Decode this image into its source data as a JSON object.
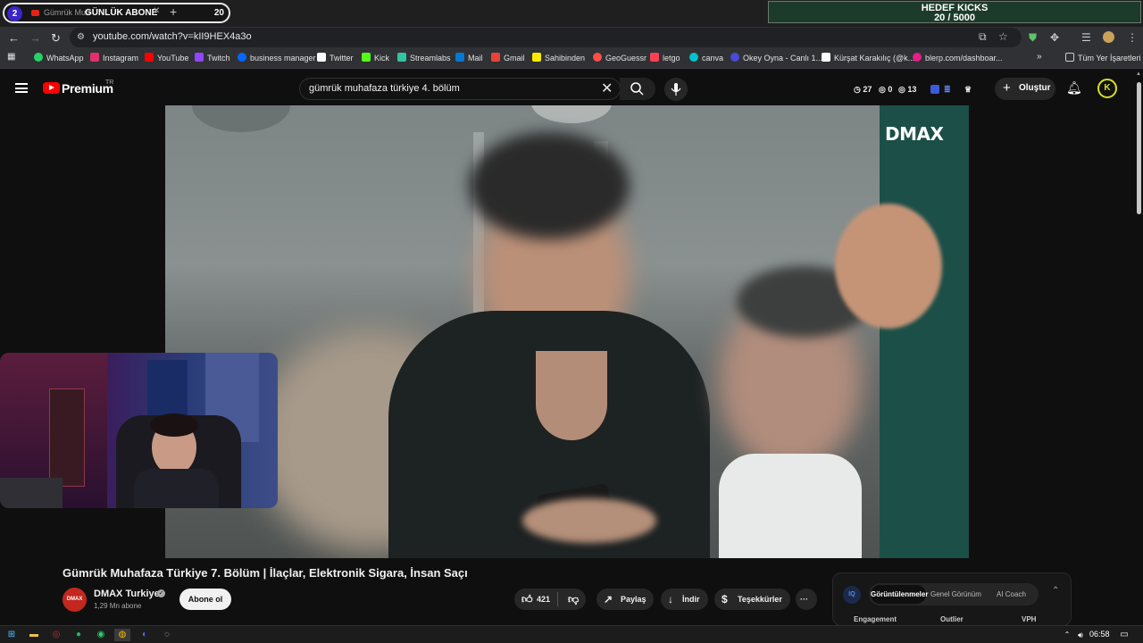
{
  "tabstrip": {
    "overlay_left_count": "2",
    "tab_title": "Gümrük Muh",
    "overlay_title": "GÜNLÜK ABONE",
    "overlay_right_count": "20",
    "new_tab_symbol": "+",
    "close_symbol": "✕"
  },
  "goal_overlay": {
    "title": "HEDEF KICKS",
    "progress_text": "20 / 5000",
    "current": 20,
    "target": 5000
  },
  "address_bar": {
    "url": "youtube.com/watch?v=kII9HEX4a3o"
  },
  "bookmarks": [
    {
      "label": "WhatsApp",
      "icon": "whatsapp-icon",
      "color": "#25d366"
    },
    {
      "label": "Instagram",
      "icon": "instagram-icon",
      "color": "#e1306c"
    },
    {
      "label": "YouTube",
      "icon": "youtube-icon",
      "color": "#ff0000"
    },
    {
      "label": "Twitch",
      "icon": "twitch-icon",
      "color": "#9146ff"
    },
    {
      "label": "business manager",
      "icon": "meta-icon",
      "color": "#0866ff"
    },
    {
      "label": "Twitter",
      "icon": "x-icon",
      "color": "#ffffff"
    },
    {
      "label": "Kick",
      "icon": "kick-icon",
      "color": "#53fc18"
    },
    {
      "label": "Streamlabs",
      "icon": "streamlabs-icon",
      "color": "#31c3a2"
    },
    {
      "label": "Mail",
      "icon": "mail-icon",
      "color": "#0078d4"
    },
    {
      "label": "Gmail",
      "icon": "gmail-icon",
      "color": "#ea4335"
    },
    {
      "label": "Sahibinden",
      "icon": "sahibinden-icon",
      "color": "#ffe800"
    },
    {
      "label": "GeoGuessr",
      "icon": "map-pin-icon",
      "color": "#ff4d4d"
    },
    {
      "label": "letgo",
      "icon": "letgo-icon",
      "color": "#ff3f55"
    },
    {
      "label": "canva",
      "icon": "canva-icon",
      "color": "#00c4cc"
    },
    {
      "label": "Okey Oyna - Canlı 1...",
      "icon": "okey-icon",
      "color": "#4a4ad8"
    },
    {
      "label": "Kürşat Karakılıç (@k...",
      "icon": "tiktok-icon",
      "color": "#ffffff"
    },
    {
      "label": "blerp.com/dashboar...",
      "icon": "blerp-icon",
      "color": "#e0218a"
    }
  ],
  "bookmarks_more": "»",
  "all_bookmarks": "Tüm Yer İşaretleri",
  "youtube_header": {
    "logo_text": "Premium",
    "region": "TR",
    "search_query": "gümrük muhafaza türkiye 4. bölüm",
    "stats": [
      "27",
      "0",
      "13"
    ],
    "create_label": "Oluştur",
    "avatar_letter": "K"
  },
  "video": {
    "channel_watermark": "DMAX",
    "title": "Gümrük Muhafaza Türkiye 7. Bölüm | İlaçlar, Elektronik Sigara, İnsan Saçı",
    "channel_name": "DMAX Turkiye",
    "channel_avatar_text": "DMAX",
    "subscribers": "1,29 Mn abone",
    "subscribe_label": "Abone ol",
    "like_count": "421",
    "share_label": "Paylaş",
    "download_label": "İndir",
    "thanks_label": "Teşekkürler",
    "more_symbol": "···"
  },
  "extension_panel": {
    "logo": "IQ",
    "tabs": [
      "Görüntülenmeler",
      "Genel Görünüm",
      "AI Coach"
    ],
    "columns": [
      "Engagement",
      "Outlier",
      "VPH"
    ]
  },
  "taskbar": {
    "time": "06:58"
  },
  "colors": {
    "youtube_red": "#ff0000",
    "kick_green": "#53fc18",
    "background": "#0f0f0f"
  }
}
